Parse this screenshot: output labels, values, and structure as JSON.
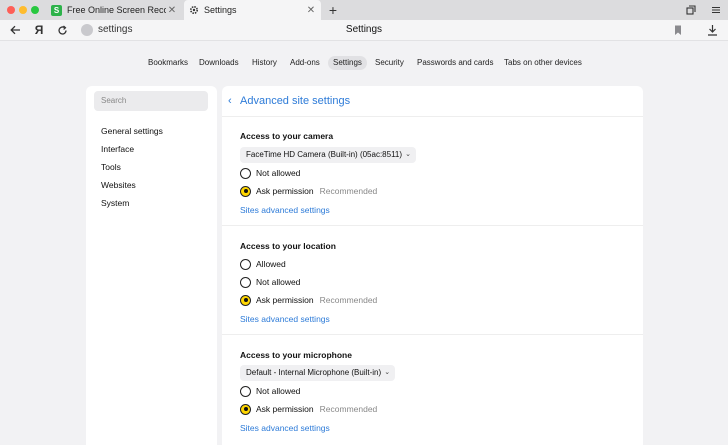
{
  "tabs": [
    {
      "label": "Free Online Screen Recorder",
      "favicon": "S",
      "favicon_color": "#2db24a"
    },
    {
      "label": "Settings",
      "favicon": "gear-icon"
    }
  ],
  "address": {
    "url": "settings",
    "page_title": "Settings"
  },
  "settings_nav": [
    {
      "label": "Bookmarks"
    },
    {
      "label": "Downloads"
    },
    {
      "label": "History"
    },
    {
      "label": "Add-ons"
    },
    {
      "label": "Settings",
      "active": true
    },
    {
      "label": "Security"
    },
    {
      "label": "Passwords and cards"
    },
    {
      "label": "Tabs on other devices"
    }
  ],
  "sidebar": {
    "search_placeholder": "Search",
    "items": [
      {
        "label": "General settings"
      },
      {
        "label": "Interface"
      },
      {
        "label": "Tools"
      },
      {
        "label": "Websites"
      },
      {
        "label": "System"
      }
    ]
  },
  "panel": {
    "title": "Advanced site settings",
    "sections": [
      {
        "title": "Access to your camera",
        "dropdown": "FaceTime HD Camera (Built-in) (05ac:8511)",
        "options": [
          {
            "label": "Not allowed",
            "selected": false
          },
          {
            "label": "Ask permission",
            "selected": true,
            "note": "Recommended"
          }
        ],
        "link": "Sites advanced settings"
      },
      {
        "title": "Access to your location",
        "options": [
          {
            "label": "Allowed",
            "selected": false
          },
          {
            "label": "Not allowed",
            "selected": false
          },
          {
            "label": "Ask permission",
            "selected": true,
            "note": "Recommended"
          }
        ],
        "link": "Sites advanced settings"
      },
      {
        "title": "Access to your microphone",
        "dropdown": "Default - Internal Microphone (Built-in)",
        "options": [
          {
            "label": "Not allowed",
            "selected": false
          },
          {
            "label": "Ask permission",
            "selected": true,
            "note": "Recommended"
          }
        ],
        "link": "Sites advanced settings"
      }
    ]
  },
  "colors": {
    "accent": "#2d7bd8",
    "radio_selected": "#ffd600"
  }
}
